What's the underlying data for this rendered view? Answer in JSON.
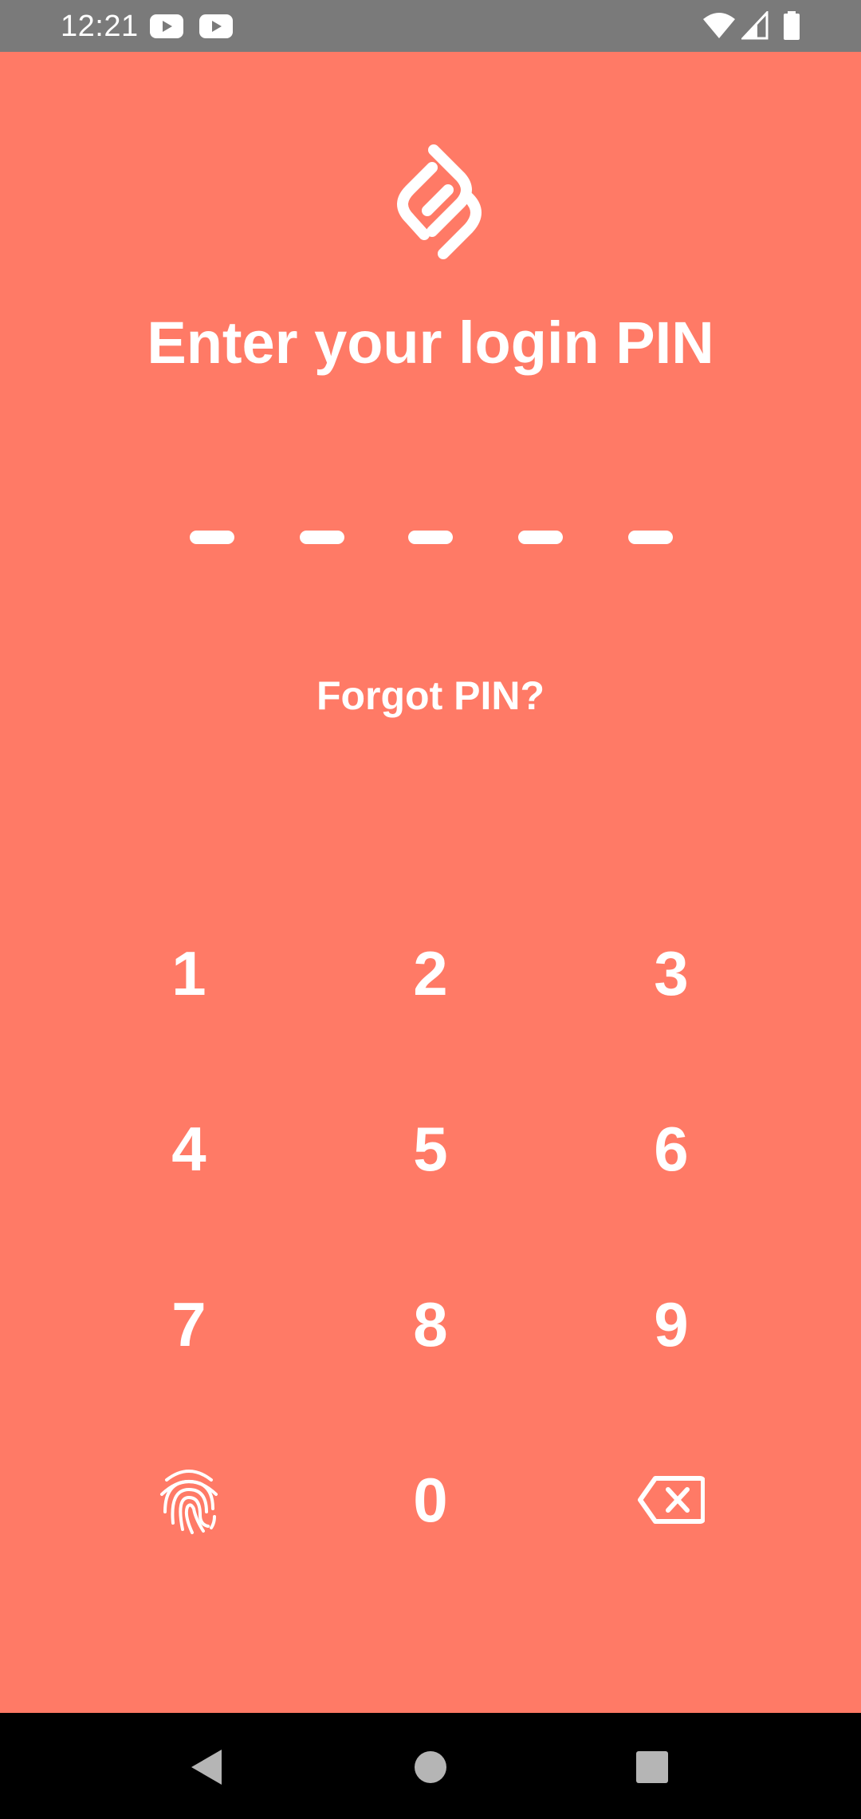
{
  "status_bar": {
    "time": "12:21",
    "notification_icons": [
      "youtube-icon",
      "youtube-icon"
    ],
    "system_icons": [
      "wifi-icon",
      "cell-signal-icon",
      "battery-icon"
    ]
  },
  "app": {
    "logo_icon": "app-logo-icon",
    "title": "Enter your login PIN",
    "pin_length": 5,
    "pin_entered": 0,
    "forgot_pin_label": "Forgot PIN?"
  },
  "keypad": {
    "keys": [
      "1",
      "2",
      "3",
      "4",
      "5",
      "6",
      "7",
      "8",
      "9",
      "",
      "0",
      ""
    ],
    "biometric_icon": "fingerprint-icon",
    "delete_icon": "backspace-icon"
  },
  "nav_bar": {
    "buttons": [
      "back-icon",
      "home-icon",
      "recents-icon"
    ]
  },
  "colors": {
    "background": "#FF7A66",
    "foreground": "#FFFFFF",
    "status_bar": "#7A7A7A",
    "nav_bar": "#000000"
  }
}
